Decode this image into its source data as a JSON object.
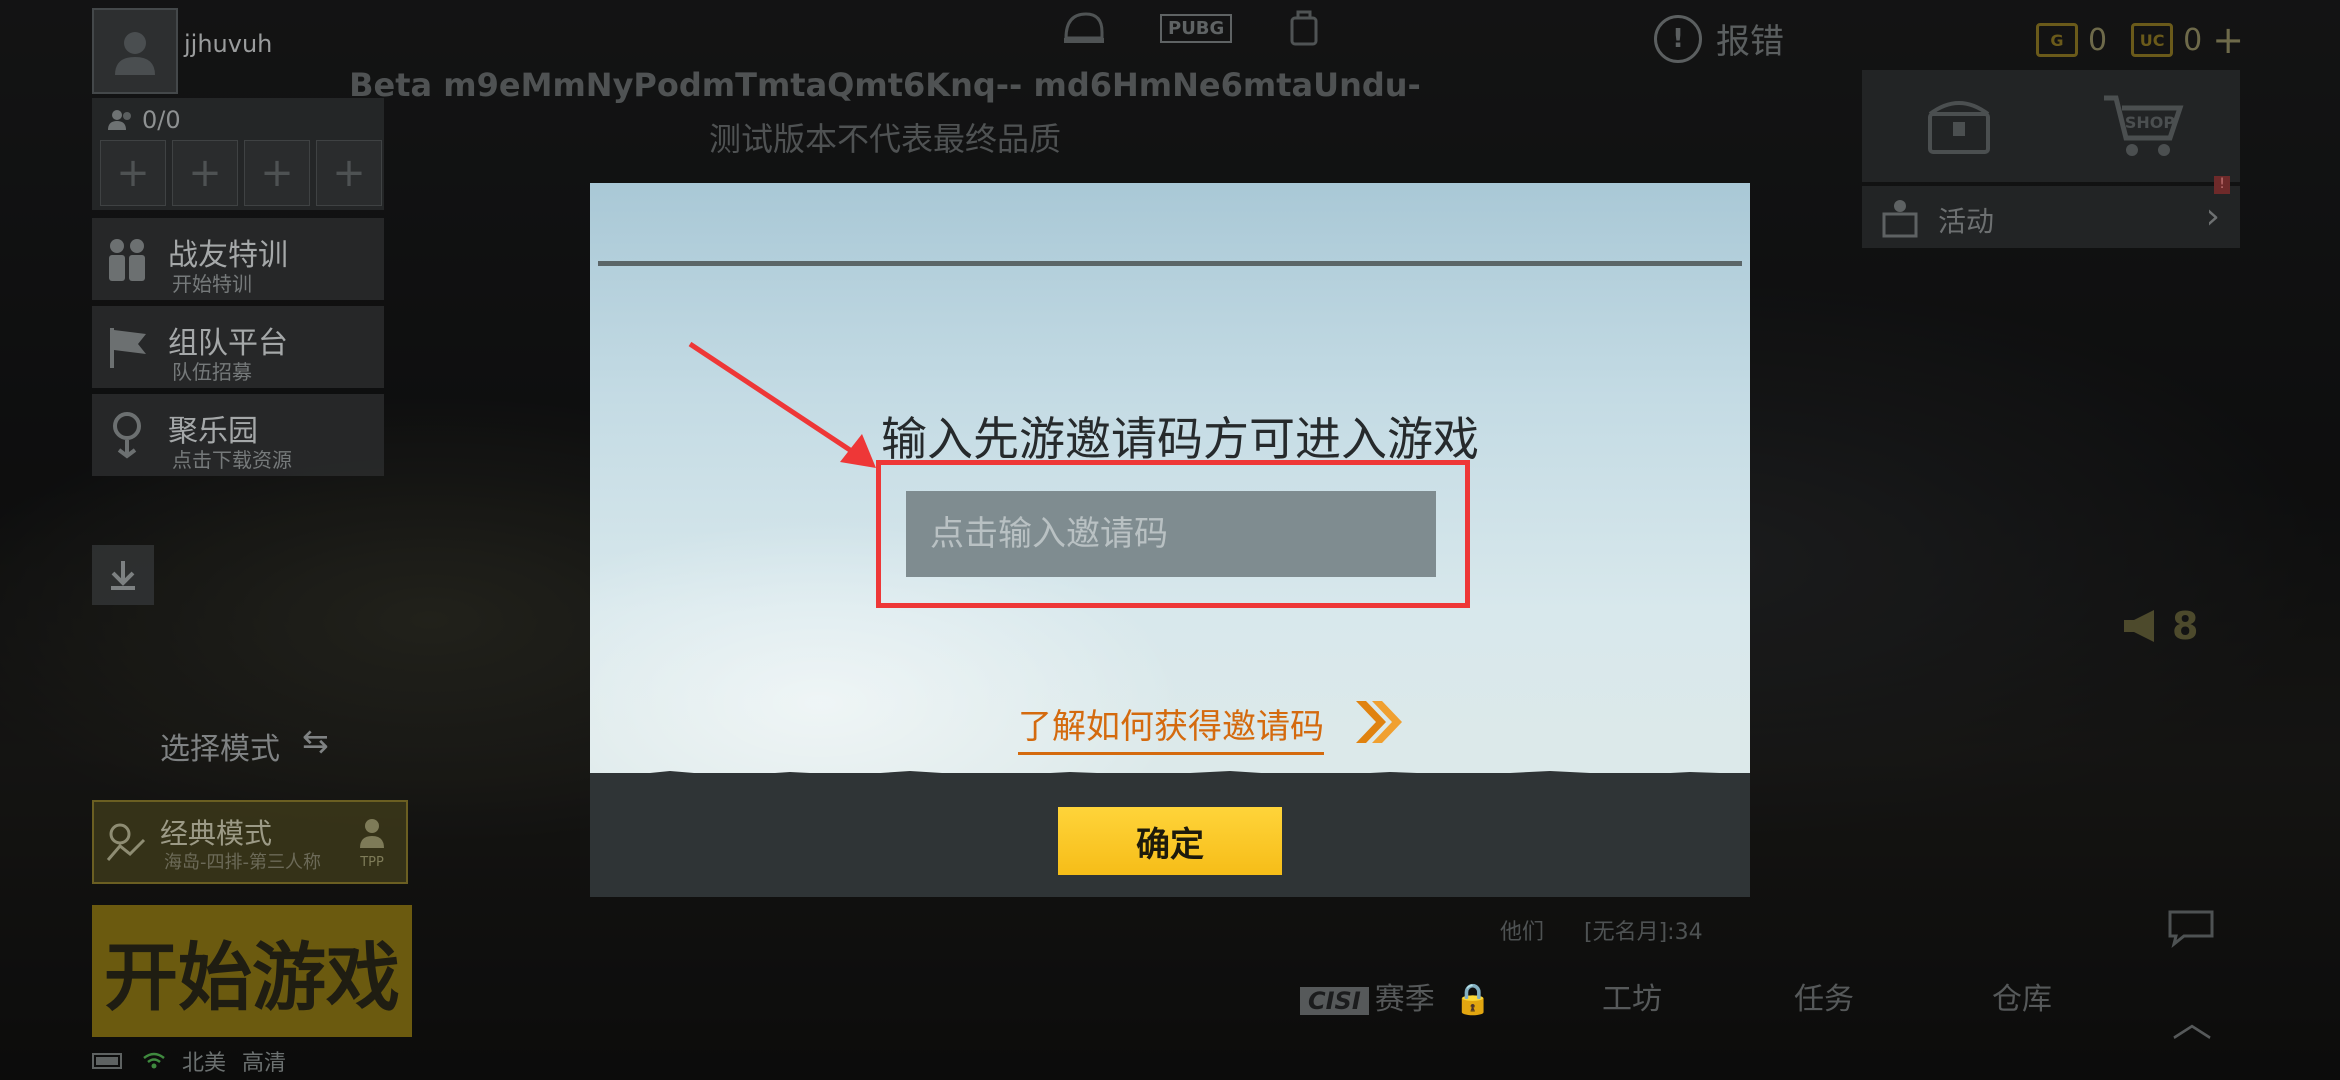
{
  "player": {
    "username": "jjhuvuh"
  },
  "team": {
    "count": "0/0",
    "slot_symbol": "+"
  },
  "menu": [
    {
      "title": "战友特训",
      "subtitle": "开始特训"
    },
    {
      "title": "组队平台",
      "subtitle": "队伍招募"
    },
    {
      "title": "聚乐园",
      "subtitle": "点击下载资源"
    }
  ],
  "mode": {
    "select_label": "选择模式",
    "classic_title": "经典模式",
    "classic_sub": "海岛-四排-第三人称",
    "tpp": "TPP"
  },
  "start_button": "开始游戏",
  "region": {
    "server": "北美",
    "quality": "高清"
  },
  "header": {
    "pubg_logo": "PUBG",
    "beta_line": "Beta m9eMmNyPodmTmtaQmt6Knq-- md6HmNe6mtaUndu-",
    "beta_sub": "测试版本不代表最终品质",
    "report_label": "报错",
    "currency": [
      {
        "icon": "G",
        "value": "0"
      },
      {
        "icon": "UC",
        "value": "0"
      }
    ],
    "currency_plus": "+"
  },
  "right": {
    "shop_label": "SHOP",
    "activity_label": "活动",
    "activity_badge": "!",
    "speaker_count": "8",
    "friend_line": [
      "他们",
      "[无名月]:34"
    ]
  },
  "bottom_nav": [
    {
      "label": "赛季",
      "prefix": "CISI"
    },
    {
      "label": "工坊"
    },
    {
      "label": "任务"
    },
    {
      "label": "仓库"
    }
  ],
  "dialog": {
    "title": "输入先游邀请码方可进入游戏",
    "input_placeholder": "点击输入邀请码",
    "input_value": "",
    "help_link": "了解如何获得邀请码",
    "confirm_label": "确定"
  },
  "colors": {
    "highlight": "#ee3737",
    "confirm_bg": "#f6bd18",
    "link": "#d46a0e"
  }
}
